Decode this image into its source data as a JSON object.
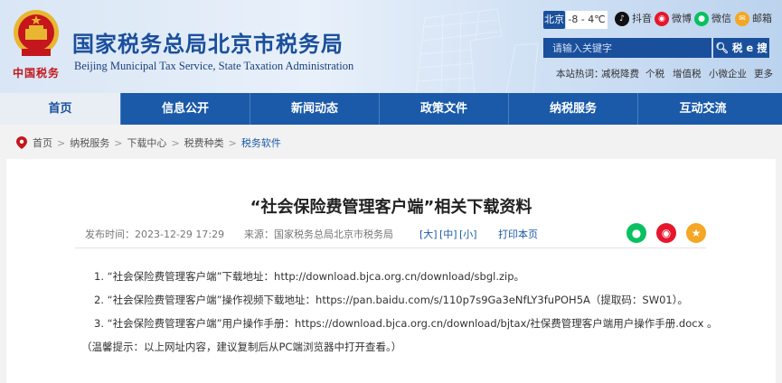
{
  "header": {
    "emblem_text": "中国税务",
    "title": "国家税务总局北京市税务局",
    "subtitle": "Beijing Municipal Tax Service, State Taxation Administration",
    "weather_city": "北京",
    "weather_temp": "-8 - 4℃",
    "social": [
      {
        "label": "抖音",
        "icon": "douyin-icon",
        "color": "#111111"
      },
      {
        "label": "微博",
        "icon": "weibo-icon",
        "color": "#e6162d"
      },
      {
        "label": "微信",
        "icon": "wechat-icon",
        "color": "#07c160"
      },
      {
        "label": "邮箱",
        "icon": "mail-icon",
        "color": "#f5a623"
      }
    ],
    "search_placeholder": "请输入关键字",
    "search_button": "税 e 搜",
    "hot_prefix": "本站热词：",
    "hot_words": [
      "减税降费",
      "个税",
      "增值税",
      "小微企业",
      "更多"
    ]
  },
  "nav": [
    "首页",
    "信息公开",
    "新闻动态",
    "政策文件",
    "纳税服务",
    "互动交流"
  ],
  "breadcrumb": [
    "首页",
    "纳税服务",
    "下载中心",
    "税费种类",
    "税务软件"
  ],
  "article": {
    "title": "“社会保险费管理客户端”相关下载资料",
    "date": "发布时间：2023-12-29 17:29",
    "source": "来源：国家税务总局北京市税务局",
    "size_large": "[大]",
    "size_medium": "[中]",
    "size_small": "[小]",
    "print": "打印本页",
    "items": [
      "1. “社会保险费管理客户端”下载地址：http://download.bjca.org.cn/download/sbgl.zip。",
      "2. “社会保险费管理客户端”操作视频下载地址：https://pan.baidu.com/s/110p7s9Ga3eNfLY3fuPOH5A（提取码：SW01）。",
      "3. “社会保险费管理客户端”用户操作手册：https://download.bjca.org.cn/download/bjtax/社保费管理客户端用户操作手册.docx 。"
    ],
    "tip": "（温馨提示：以上网址内容，建议复制后从PC端浏览器中打开查看。）"
  },
  "colors": {
    "primary": "#1a5aa8",
    "title": "#1a4f9c",
    "emblem_red": "#c4161c"
  }
}
